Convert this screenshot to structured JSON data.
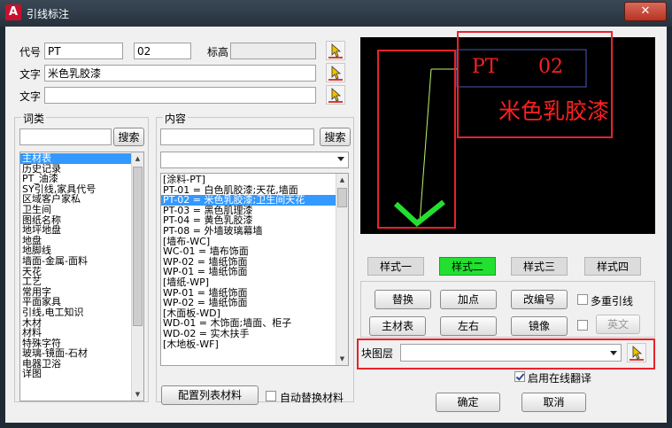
{
  "window": {
    "title": "引线标注",
    "app_icon": "A",
    "close": "✕"
  },
  "fields": {
    "code_label": "代号",
    "code_value": "PT",
    "code2_value": "02",
    "elevation_label": "标高",
    "elevation_value": "",
    "text_label": "文字",
    "text1_value": "米色乳胶漆",
    "text2_label": "文字",
    "text2_value": ""
  },
  "category": {
    "label": "词类",
    "search_value": "",
    "search_button": "搜索",
    "items": [
      "主材表",
      "历史记录",
      "PT_油漆",
      "SY引线,家具代号",
      "区域客户家私",
      "卫生间",
      "图纸名称",
      "地坪地盘",
      "地盘",
      "地脚线",
      "墙面-金属-面料",
      "天花",
      "工艺",
      "常用字",
      "平面家具",
      "引线,电工知识",
      "木材",
      "材料",
      "特殊字符",
      "玻璃-镜面-石材",
      "电器卫浴",
      "详图"
    ],
    "selected_index": 0
  },
  "content": {
    "label": "内容",
    "search_value": "",
    "search_button": "搜索",
    "combo_value": "",
    "items": [
      "[涂料-PT]",
      "PT-01 = 白色肌胶漆;天花,墙面",
      "PT-02 = 米色乳胶漆;卫生间天花",
      "PT-03 = 黑色肌理漆",
      "PT-04 = 黄色乳胶漆",
      "PT-08 = 外墙玻璃幕墙",
      "[墙布-WC]",
      "WC-01 = 墙布饰面",
      "WP-02 = 墙纸饰面",
      "WP-01 = 墙纸饰面",
      "[墙纸-WP]",
      "WP-01 = 墙纸饰面",
      "WP-02 = 墙纸饰面",
      "[木面板-WD]",
      "WD-01 = 木饰面;墙面、柜子",
      "WD-02 = 实木扶手",
      "[木地板-WF]"
    ],
    "selected_index": 2,
    "config_button": "配置列表材料",
    "auto_replace_label": "自动替换材料"
  },
  "preview": {
    "code_text": "PT",
    "number_text": "02",
    "name_text": "米色乳胶漆"
  },
  "styles": {
    "items": [
      "样式一",
      "样式二",
      "样式三",
      "样式四"
    ],
    "active_index": 1
  },
  "actions": {
    "replace": "替换",
    "add_point": "加点",
    "renumber": "改编号",
    "multi_leader": "多重引线",
    "main_table": "主材表",
    "left_right": "左右",
    "mirror": "镜像",
    "english": "英文"
  },
  "layer": {
    "label": "块图层",
    "value": ""
  },
  "online_translate": {
    "label": "启用在线翻译",
    "checked": true
  },
  "footer": {
    "ok": "确定",
    "cancel": "取消"
  },
  "colors": {
    "accent_green": "#22e030",
    "highlight_red": "#e8232a",
    "preview_red": "#ff2020",
    "leader_green": "#22e030"
  }
}
